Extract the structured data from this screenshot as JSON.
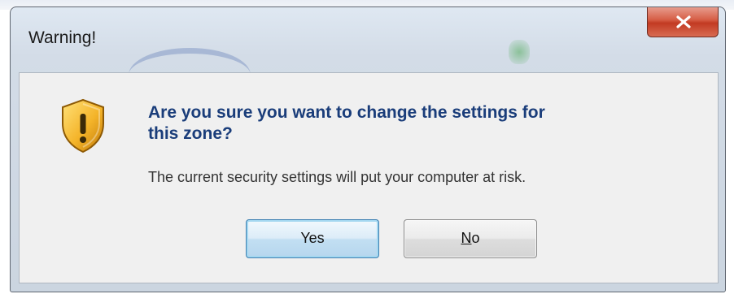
{
  "dialog": {
    "title": "Warning!",
    "close_icon": "close-x-icon",
    "warning_icon": "shield-warning-icon",
    "heading_line1": "Are you sure you want to change the settings for",
    "heading_line2": "this zone?",
    "message": "The current security settings will put your computer at risk.",
    "buttons": {
      "yes_label": "Yes",
      "no_mnemonic": "N",
      "no_rest": "o"
    }
  },
  "colors": {
    "heading": "#1a3d7a",
    "close_button": "#c8452e",
    "default_button_border": "#3c7fb1"
  }
}
